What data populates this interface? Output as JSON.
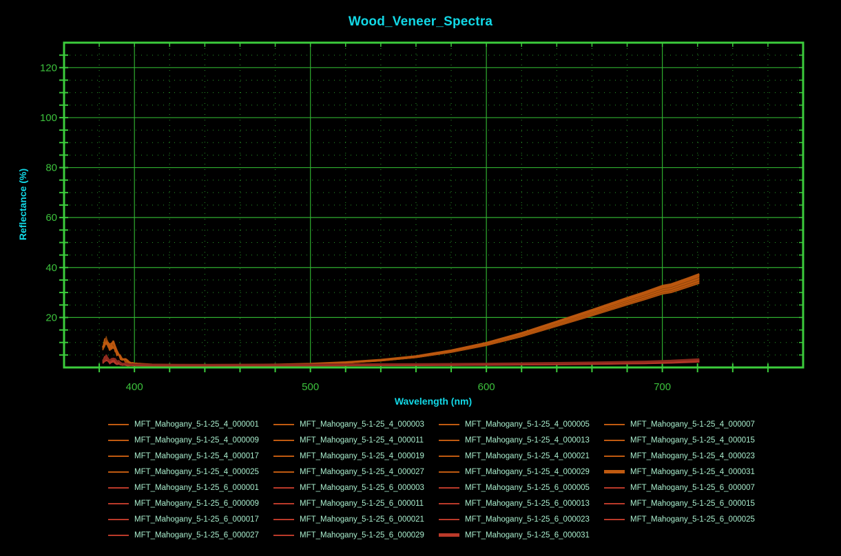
{
  "chart_data": {
    "type": "line",
    "title": "Wood_Veneer_Spectra",
    "xlabel": "Wavelength (nm)",
    "ylabel": "Reflectance (%)",
    "xlim": [
      360,
      780
    ],
    "ylim": [
      0,
      130
    ],
    "x_major_ticks": [
      400,
      500,
      600,
      700
    ],
    "y_major_ticks": [
      20,
      40,
      60,
      80,
      100,
      120
    ],
    "x_minor_step": 20,
    "y_minor_step": 5,
    "grid": {
      "major": "solid",
      "minor": "dotted"
    },
    "legend_position": "bottom",
    "x_data_range": [
      382,
      721
    ],
    "colors": {
      "background": "#000000",
      "grid_major": "#2fae2f",
      "grid_minor": "#2a9e2a",
      "border": "#3ccc3c",
      "tick_label": "#3cc13c",
      "title": "#12d8e6",
      "axis_label": "#12d8e6",
      "legend_text": "#a9edcd"
    },
    "groups": [
      {
        "prefix": "MFT_Mahogany_5-1-25_4",
        "color": "#c05a10",
        "color_dark": "#8a4309",
        "spread_pct": 5,
        "noise_region": [
          382,
          402
        ],
        "noise_amp": 1.6,
        "base_curve": {
          "x": [
            382,
            384,
            386,
            388,
            390,
            392,
            394,
            396,
            398,
            400,
            410,
            420,
            440,
            460,
            480,
            500,
            520,
            540,
            560,
            580,
            600,
            620,
            640,
            660,
            680,
            690,
            700,
            705,
            710,
            715,
            721
          ],
          "y": [
            9.0,
            10.5,
            7.8,
            8.8,
            5.8,
            4.2,
            3.0,
            2.2,
            1.7,
            1.4,
            1.0,
            0.9,
            0.85,
            0.9,
            1.0,
            1.3,
            1.9,
            2.8,
            4.2,
            6.4,
            9.3,
            13.0,
            17.4,
            21.8,
            26.4,
            28.6,
            31.0,
            31.6,
            32.8,
            34.0,
            35.5
          ]
        }
      },
      {
        "prefix": "MFT_Mahogany_5-1-25_6",
        "color": "#bb3a2a",
        "color_dark": "#8c2a1e",
        "spread_pct": 18,
        "noise_region": [
          382,
          402
        ],
        "noise_amp": 0.7,
        "base_curve": {
          "x": [
            382,
            384,
            386,
            388,
            390,
            392,
            394,
            396,
            398,
            400,
            410,
            420,
            440,
            460,
            480,
            500,
            520,
            540,
            560,
            580,
            600,
            620,
            640,
            660,
            680,
            690,
            700,
            705,
            710,
            715,
            721
          ],
          "y": [
            2.8,
            3.6,
            2.4,
            3.0,
            2.0,
            1.6,
            1.3,
            1.1,
            1.0,
            0.95,
            0.85,
            0.8,
            0.8,
            0.82,
            0.85,
            0.9,
            0.95,
            1.0,
            1.05,
            1.1,
            1.2,
            1.3,
            1.45,
            1.6,
            1.8,
            1.9,
            2.1,
            2.2,
            2.35,
            2.5,
            2.7
          ]
        }
      }
    ],
    "series": [
      {
        "label": "MFT_Mahogany_5-1-25_4_000001",
        "group": 0,
        "bold": false
      },
      {
        "label": "MFT_Mahogany_5-1-25_4_000003",
        "group": 0,
        "bold": false
      },
      {
        "label": "MFT_Mahogany_5-1-25_4_000005",
        "group": 0,
        "bold": false
      },
      {
        "label": "MFT_Mahogany_5-1-25_4_000007",
        "group": 0,
        "bold": false
      },
      {
        "label": "MFT_Mahogany_5-1-25_4_000009",
        "group": 0,
        "bold": false
      },
      {
        "label": "MFT_Mahogany_5-1-25_4_000011",
        "group": 0,
        "bold": false
      },
      {
        "label": "MFT_Mahogany_5-1-25_4_000013",
        "group": 0,
        "bold": false
      },
      {
        "label": "MFT_Mahogany_5-1-25_4_000015",
        "group": 0,
        "bold": false
      },
      {
        "label": "MFT_Mahogany_5-1-25_4_000017",
        "group": 0,
        "bold": false
      },
      {
        "label": "MFT_Mahogany_5-1-25_4_000019",
        "group": 0,
        "bold": false
      },
      {
        "label": "MFT_Mahogany_5-1-25_4_000021",
        "group": 0,
        "bold": false
      },
      {
        "label": "MFT_Mahogany_5-1-25_4_000023",
        "group": 0,
        "bold": false
      },
      {
        "label": "MFT_Mahogany_5-1-25_4_000025",
        "group": 0,
        "bold": false
      },
      {
        "label": "MFT_Mahogany_5-1-25_4_000027",
        "group": 0,
        "bold": false
      },
      {
        "label": "MFT_Mahogany_5-1-25_4_000029",
        "group": 0,
        "bold": false
      },
      {
        "label": "MFT_Mahogany_5-1-25_4_000031",
        "group": 0,
        "bold": true
      },
      {
        "label": "MFT_Mahogany_5-1-25_6_000001",
        "group": 1,
        "bold": false
      },
      {
        "label": "MFT_Mahogany_5-1-25_6_000003",
        "group": 1,
        "bold": false
      },
      {
        "label": "MFT_Mahogany_5-1-25_6_000005",
        "group": 1,
        "bold": false
      },
      {
        "label": "MFT_Mahogany_5-1-25_6_000007",
        "group": 1,
        "bold": false
      },
      {
        "label": "MFT_Mahogany_5-1-25_6_000009",
        "group": 1,
        "bold": false
      },
      {
        "label": "MFT_Mahogany_5-1-25_6_000011",
        "group": 1,
        "bold": false
      },
      {
        "label": "MFT_Mahogany_5-1-25_6_000013",
        "group": 1,
        "bold": false
      },
      {
        "label": "MFT_Mahogany_5-1-25_6_000015",
        "group": 1,
        "bold": false
      },
      {
        "label": "MFT_Mahogany_5-1-25_6_000017",
        "group": 1,
        "bold": false
      },
      {
        "label": "MFT_Mahogany_5-1-25_6_000021",
        "group": 1,
        "bold": false
      },
      {
        "label": "MFT_Mahogany_5-1-25_6_000023",
        "group": 1,
        "bold": false
      },
      {
        "label": "MFT_Mahogany_5-1-25_6_000025",
        "group": 1,
        "bold": false
      },
      {
        "label": "MFT_Mahogany_5-1-25_6_000027",
        "group": 1,
        "bold": false
      },
      {
        "label": "MFT_Mahogany_5-1-25_6_000029",
        "group": 1,
        "bold": false
      },
      {
        "label": "MFT_Mahogany_5-1-25_6_000031",
        "group": 1,
        "bold": true
      }
    ]
  },
  "legend": {
    "columns": 4
  }
}
